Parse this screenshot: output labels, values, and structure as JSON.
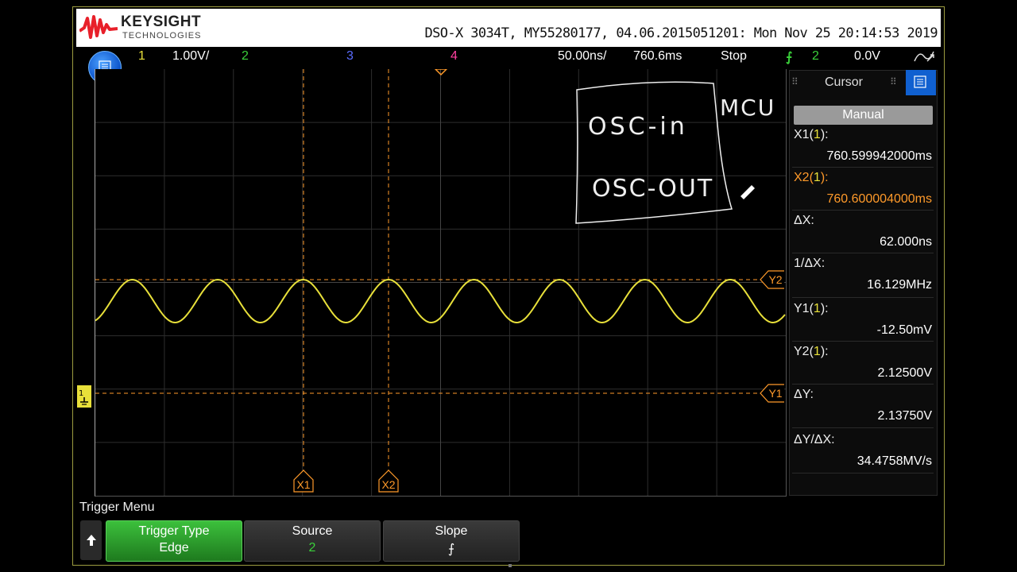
{
  "colors": {
    "channel1": "#e8e03a",
    "channel2": "#3ad03a",
    "channel3": "#5a6cff",
    "channel4": "#ff40a0",
    "cursor": "#ff9a2a",
    "accent_blue": "#1060d0",
    "active_softkey": "#2c9c2c"
  },
  "header": {
    "brand": "KEYSIGHT",
    "brand_sub": "TECHNOLOGIES",
    "info": "DSO-X 3034T, MY55280177, 04.06.2015051201: Mon Nov 25 20:14:53 2019"
  },
  "status_bar": {
    "ch1_label": "1",
    "ch1_scale": "1.00V/",
    "ch2_label": "2",
    "ch3_label": "3",
    "ch4_label": "4",
    "timebase": "50.00ns/",
    "delay": "760.6ms",
    "run_state": "Stop",
    "trigger_source": "2",
    "trigger_level": "0.0V"
  },
  "scope": {
    "cursor_labels": {
      "x1": "X1",
      "x2": "X2",
      "y1": "Y1",
      "y2": "Y2"
    },
    "annotation": {
      "mcu": "MCU",
      "osc_in": "OSC-in",
      "osc_out": "OSC-OUT"
    }
  },
  "side_panel": {
    "title": "Cursor",
    "mode": "Manual",
    "rows": [
      {
        "label_prefix": "X1(",
        "label_ch": "1",
        "label_suffix": "):",
        "value": "760.599942000ms"
      },
      {
        "label_prefix": "X2(",
        "label_ch": "1",
        "label_suffix": "):",
        "value": "760.600004000ms"
      },
      {
        "label": "ΔX:",
        "value": "62.000ns"
      },
      {
        "label": "1/ΔX:",
        "value": "16.129MHz"
      },
      {
        "label_prefix": "Y1(",
        "label_ch": "1",
        "label_suffix": "):",
        "value": "-12.50mV"
      },
      {
        "label_prefix": "Y2(",
        "label_ch": "1",
        "label_suffix": "):",
        "value": "2.12500V"
      },
      {
        "label": "ΔY:",
        "value": "2.13750V"
      },
      {
        "label": "ΔY/ΔX:",
        "value": "34.4758MV/s"
      }
    ]
  },
  "bottom": {
    "menu_title": "Trigger Menu",
    "softkeys": [
      {
        "label": "Trigger Type",
        "value": "Edge"
      },
      {
        "label": "Source",
        "value": "2"
      },
      {
        "label": "Slope",
        "value": "⨍"
      }
    ]
  }
}
